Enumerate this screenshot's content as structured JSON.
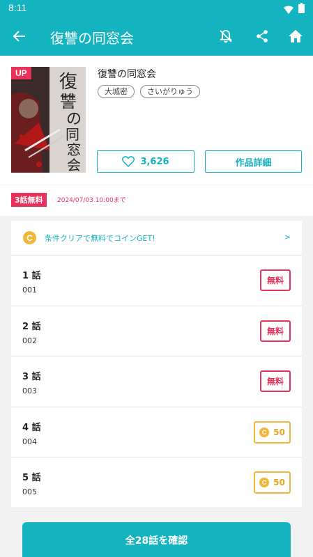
{
  "status": {
    "time": "8:11"
  },
  "appbar": {
    "title": "復讐の同窓会"
  },
  "book": {
    "badge": "UP",
    "title": "復讐の同窓会",
    "authors": [
      "大城密",
      "さいがりゅう"
    ],
    "likes": "3,626",
    "detail_label": "作品詳細",
    "cover_text": "復讐の同窓会"
  },
  "free_bar": {
    "badge": "3話無料",
    "until": "2024/07/03 10:00まで"
  },
  "coin_banner": {
    "icon": "C",
    "text": "条件クリアで無料でコインGET!",
    "arrow": ">"
  },
  "episodes": [
    {
      "title": "1 話",
      "sub": "001",
      "type": "free",
      "label": "無料"
    },
    {
      "title": "2 話",
      "sub": "002",
      "type": "free",
      "label": "無料"
    },
    {
      "title": "3 話",
      "sub": "003",
      "type": "free",
      "label": "無料"
    },
    {
      "title": "4 話",
      "sub": "004",
      "type": "coin",
      "label": "50",
      "icon": "C"
    },
    {
      "title": "5 話",
      "sub": "005",
      "type": "coin",
      "label": "50",
      "icon": "C"
    }
  ],
  "all_button": "全28話を確認",
  "colors": {
    "teal": "#14b3c0",
    "pink": "#e8315b",
    "gold": "#f3b63a"
  }
}
